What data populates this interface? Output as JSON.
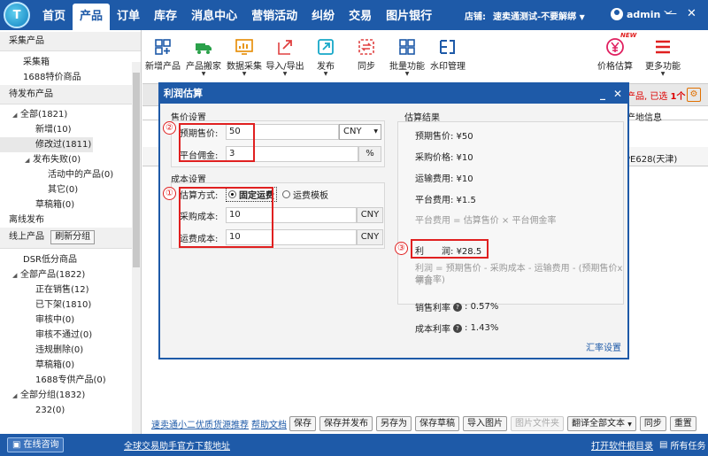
{
  "nav": {
    "items": [
      "首页",
      "产品",
      "订单",
      "库存",
      "消息中心",
      "营销活动",
      "纠纷",
      "交易",
      "图片银行"
    ],
    "active_index": 1,
    "store_label": "店铺:",
    "store_value": "速卖通测试-不要解绑",
    "username": "admin",
    "logo_text": "T"
  },
  "sidebar": {
    "collect_header": "采集产品",
    "collect_items": [
      "采集箱",
      "1688特价商品"
    ],
    "pending_header": "待发布产品",
    "pending_items": [
      {
        "label": "全部(1821)",
        "level": 1,
        "expand": "open"
      },
      {
        "label": "新增(10)",
        "level": 2
      },
      {
        "label": "修改过(1811)",
        "level": 2,
        "selected": true
      },
      {
        "label": "发布失败(0)",
        "level": 2,
        "expand": "open"
      },
      {
        "label": "活动中的产品(0)",
        "level": 3
      },
      {
        "label": "其它(0)",
        "level": 3
      },
      {
        "label": "草稿箱(0)",
        "level": 2
      }
    ],
    "offline": "离线发布",
    "online_header": "线上产品",
    "refresh_button": "刷新分组",
    "online_items": [
      {
        "label": "DSR低分商品",
        "level": 1
      },
      {
        "label": "全部产品(1822)",
        "level": 1,
        "expand": "open"
      },
      {
        "label": "正在销售(12)",
        "level": 2
      },
      {
        "label": "已下架(1810)",
        "level": 2
      },
      {
        "label": "审核中(0)",
        "level": 2
      },
      {
        "label": "审核不通过(0)",
        "level": 2
      },
      {
        "label": "违规删除(0)",
        "level": 2
      },
      {
        "label": "草稿箱(0)",
        "level": 2
      },
      {
        "label": "1688专供产品(0)",
        "level": 2
      },
      {
        "label": "全部分组(1832)",
        "level": 1,
        "expand": "open"
      },
      {
        "label": "232(0)",
        "level": 2
      }
    ]
  },
  "toolbar": {
    "buttons": [
      {
        "label": "新增产品",
        "icon": "add-product-icon",
        "dropdown": false
      },
      {
        "label": "产品搬家",
        "icon": "truck-icon",
        "dropdown": true
      },
      {
        "label": "数据采集",
        "icon": "data-collect-icon",
        "dropdown": true
      },
      {
        "label": "导入/导出",
        "icon": "import-export-icon",
        "dropdown": true
      },
      {
        "label": "发布",
        "icon": "publish-icon",
        "dropdown": true
      },
      {
        "label": "同步",
        "icon": "sync-icon",
        "dropdown": false
      },
      {
        "label": "批量功能",
        "icon": "batch-icon",
        "dropdown": true
      },
      {
        "label": "水印管理",
        "icon": "watermark-icon",
        "dropdown": false
      }
    ],
    "price_estimate": "价格估算",
    "price_badge": "NEW",
    "more": "更多功能"
  },
  "background": {
    "selected_prefix": "产品, 已选",
    "selected_count": "1个",
    "col_header": "产地信息",
    "cell_text": "PE628(天津)"
  },
  "dialog": {
    "title": "利润估算",
    "sale": {
      "header": "售价设置",
      "price_label": "预期售价:",
      "price_value": "50",
      "currency": "CNY",
      "commission_label": "平台佣金:",
      "commission_value": "3",
      "commission_unit": "%"
    },
    "cost": {
      "header": "成本设置",
      "method_label": "估算方式:",
      "method_fixed": "固定运费",
      "method_template": "运费模板",
      "purchase_label": "采购成本:",
      "purchase_value": "10",
      "purchase_unit": "CNY",
      "shipping_label": "运费成本:",
      "shipping_value": "10",
      "shipping_unit": "CNY"
    },
    "result": {
      "header": "估算结果",
      "lines": [
        "预期售价: ¥50",
        "采购价格: ¥10",
        "运输费用: ¥10",
        "平台费用: ¥1.5"
      ],
      "platform_formula": "平台费用 = 估算售价 × 平台佣金率",
      "profit_label": "利　　润:",
      "profit_value": "¥28.5",
      "profit_formula_line1": "利润 = 预期售价 - 采购成本 - 运输费用 - (预期售价x平台",
      "profit_formula_line2": "佣金率)",
      "sales_margin_label": "销售利率",
      "sales_margin_value": "0.57%",
      "cost_margin_label": "成本利率",
      "cost_margin_value": "1.43%",
      "fx_link": "汇率设置"
    },
    "markers": [
      "②",
      "①",
      "③"
    ]
  },
  "bottom": {
    "link1": "速卖通小二优质货源推荐",
    "link2": "帮助文档",
    "buttons": [
      "保存",
      "保存并发布",
      "另存为",
      "保存草稿",
      "导入图片",
      "图片文件夹",
      "翻译全部文本",
      "同步",
      "重置"
    ]
  },
  "status": {
    "consult": "在线咨询",
    "download": "全球交易助手官方下载地址",
    "log": "打开软件根目录",
    "tasks": "所有任务"
  }
}
